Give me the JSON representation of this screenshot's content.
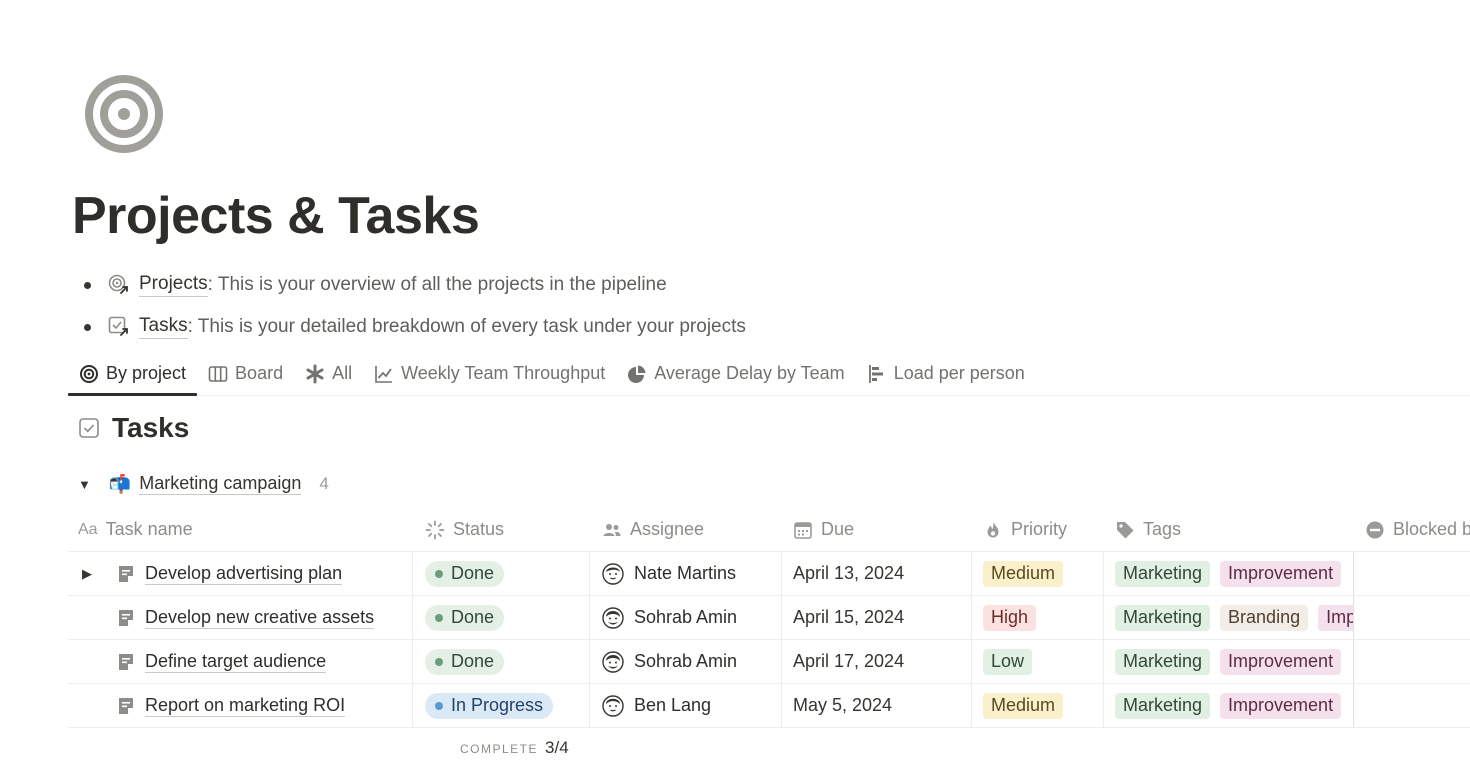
{
  "page": {
    "icon": "target-icon",
    "title": "Projects & Tasks"
  },
  "bullets": [
    {
      "icon": "projects-link-icon",
      "link": "Projects",
      "text": ": This is your overview of all the projects in the pipeline"
    },
    {
      "icon": "tasks-link-icon",
      "link": "Tasks",
      "text": ": This is your detailed breakdown of every task under your projects"
    }
  ],
  "tabs": [
    {
      "label": "By project",
      "icon": "target-icon",
      "active": true
    },
    {
      "label": "Board",
      "icon": "board-icon"
    },
    {
      "label": "All",
      "icon": "asterisk-icon"
    },
    {
      "label": "Weekly Team Throughput",
      "icon": "line-chart-icon"
    },
    {
      "label": "Average Delay by Team",
      "icon": "pie-chart-icon"
    },
    {
      "label": "Load per person",
      "icon": "bar-chart-icon"
    }
  ],
  "database": {
    "title": "Tasks",
    "icon": "checkbox-icon"
  },
  "group": {
    "emoji": "📬",
    "name": "Marketing campaign",
    "count": "4"
  },
  "columns": {
    "name_prefix": "Aa",
    "name": "Task name",
    "status": "Status",
    "assignee": "Assignee",
    "due": "Due",
    "priority": "Priority",
    "tags": "Tags",
    "blocked": "Blocked b"
  },
  "rows": [
    {
      "name": "Develop advertising plan",
      "status": "Done",
      "assignee": "Nate Martins",
      "due": "April 13, 2024",
      "priority": "Medium",
      "tags": [
        "Marketing",
        "Improvement"
      ]
    },
    {
      "name": "Develop new creative assets",
      "status": "Done",
      "assignee": "Sohrab Amin",
      "due": "April 15, 2024",
      "priority": "High",
      "tags": [
        "Marketing",
        "Branding",
        "Improvement"
      ]
    },
    {
      "name": "Define target audience",
      "status": "Done",
      "assignee": "Sohrab Amin",
      "due": "April 17, 2024",
      "priority": "Low",
      "tags": [
        "Marketing",
        "Improvement"
      ]
    },
    {
      "name": "Report on marketing ROI",
      "status": "In Progress",
      "assignee": "Ben Lang",
      "due": "May 5, 2024",
      "priority": "Medium",
      "tags": [
        "Marketing",
        "Improvement"
      ]
    }
  ],
  "footer": {
    "label": "COMPLETE",
    "value": "3/4"
  },
  "colors": {
    "done": "#e4efe6",
    "in_progress": "#dbe8f5",
    "medium": "#fbf0cc",
    "high": "#fbe2e0",
    "low": "#e2efe3",
    "marketing": "#e2efe3",
    "improvement": "#f5e1ec",
    "branding": "#f3ede7"
  }
}
